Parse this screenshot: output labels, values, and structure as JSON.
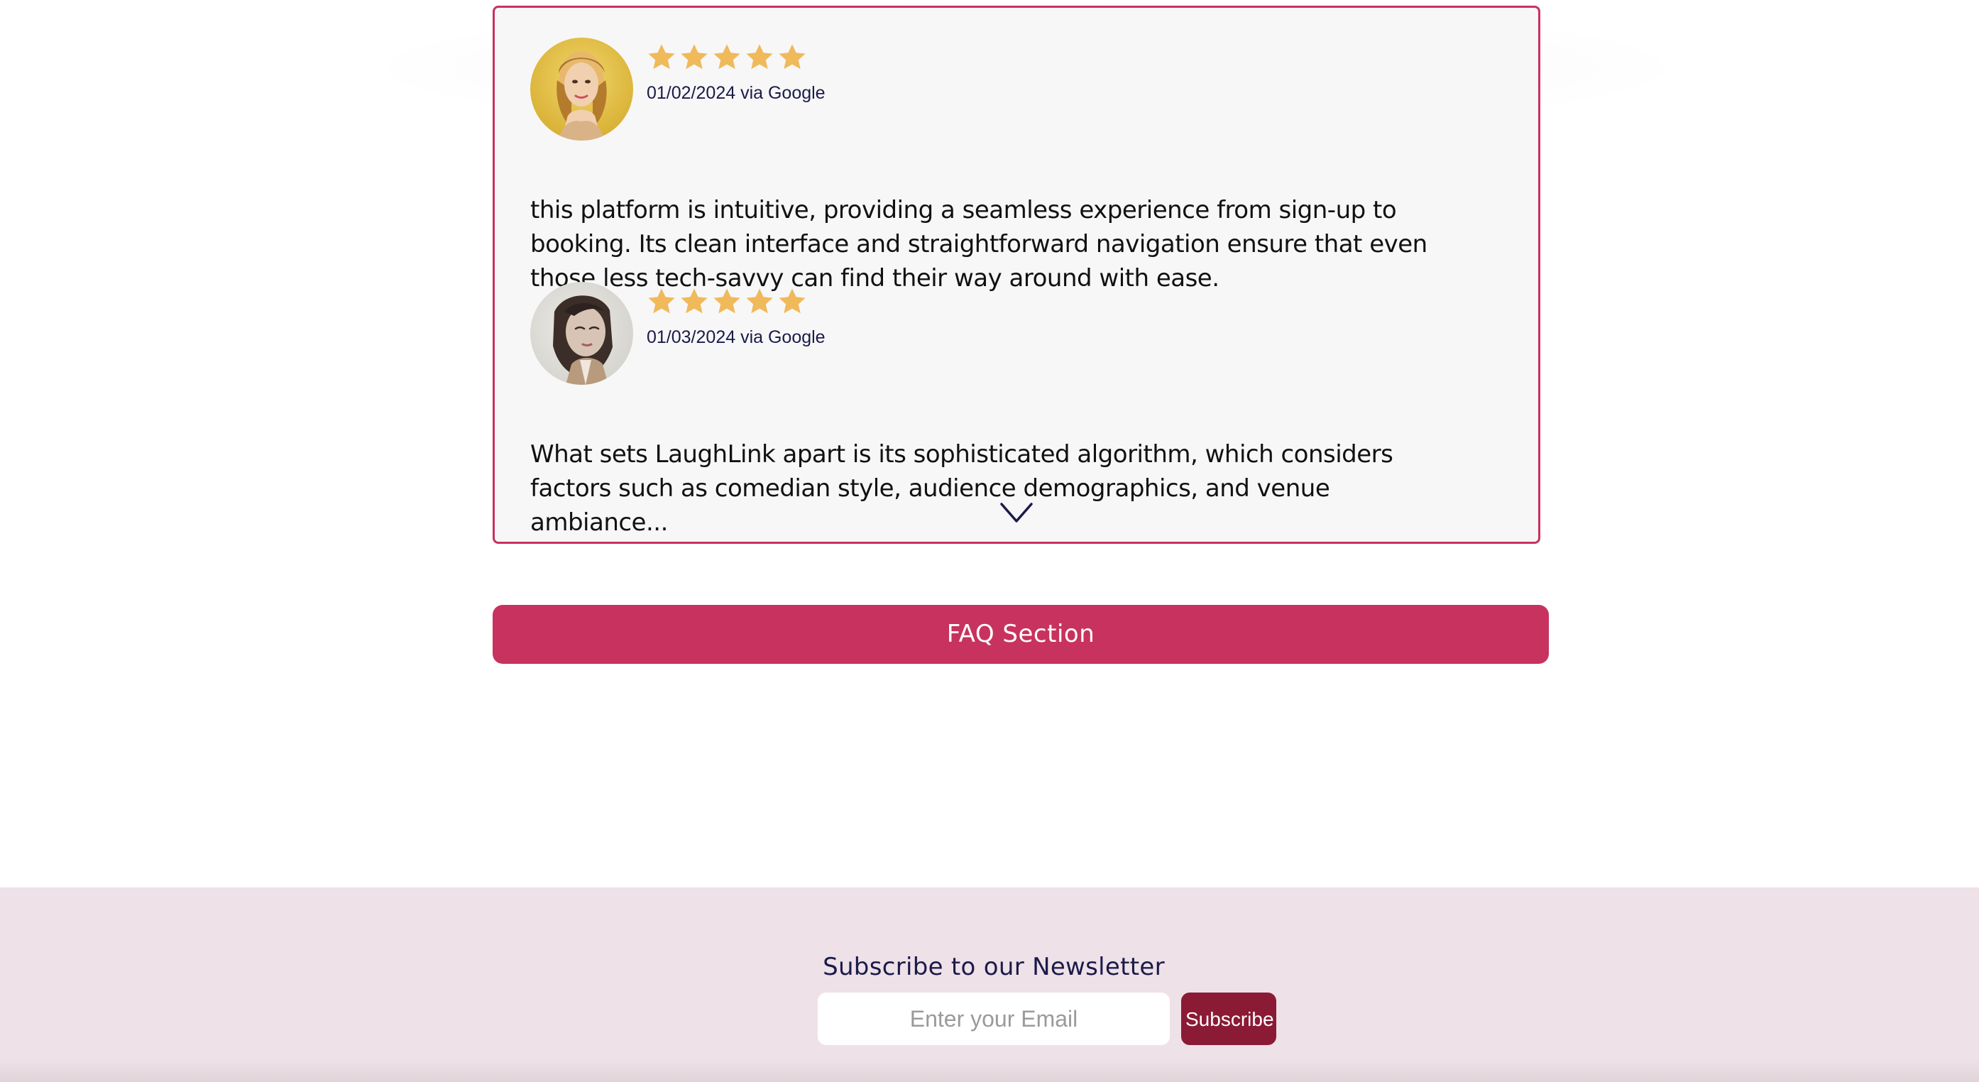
{
  "reviews": {
    "items": [
      {
        "rating": 5,
        "date_source": "01/02/2024 via Google",
        "text": "this platform is intuitive, providing a seamless experience from sign-up to booking. Its clean interface and straightforward navigation ensure that even those less tech-savvy can find their way around with ease."
      },
      {
        "rating": 5,
        "date_source": "01/03/2024 via Google",
        "text": "What sets LaughLink apart is its sophisticated algorithm, which considers factors such as comedian style, audience demographics, and venue ambiance..."
      }
    ],
    "expand_icon": "chevron-down-icon",
    "star_icon": "star-icon"
  },
  "faq": {
    "button_label": "FAQ Section"
  },
  "newsletter": {
    "title": "Subscribe to our Newsletter",
    "email_placeholder": "Enter your Email",
    "email_value": "",
    "subscribe_label": "Subscribe"
  },
  "colors": {
    "accent": "#c8325f",
    "subscribe_button": "#8b1a35",
    "star": "#f0b95a",
    "footer_bg": "#eee1e7",
    "card_bg": "#f7f7f7",
    "text_dark": "#1b1b4a"
  }
}
